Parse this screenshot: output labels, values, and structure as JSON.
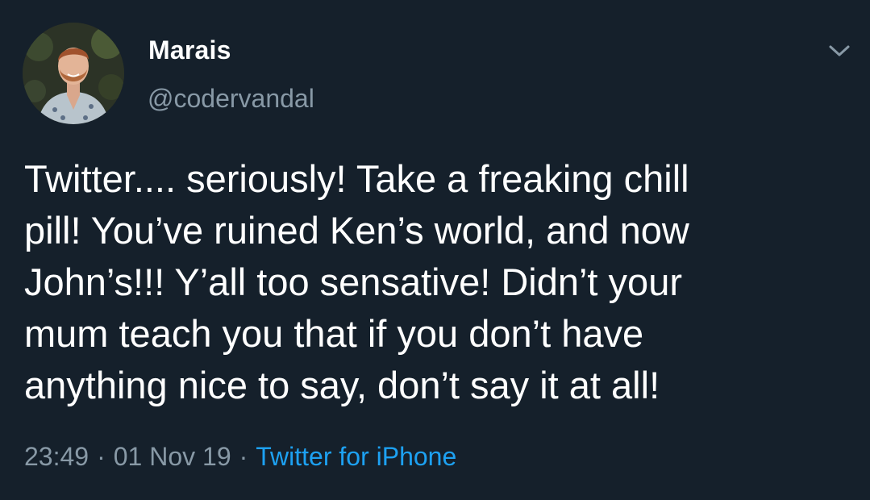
{
  "author": {
    "display_name": "Marais",
    "handle": "@codervandal"
  },
  "menu": {
    "icon": "chevron-down-icon"
  },
  "tweet": {
    "text": "Twitter.... seriously! Take a freaking chill\npill! You’ve ruined Ken’s world, and now\nJohn’s!!! Y’all too sensative! Didn’t your\nmum teach you that if you don’t have\nanything nice to say, don’t say it at all!",
    "time": "23:49",
    "separator": "·",
    "date": "01 Nov 19",
    "source": "Twitter for iPhone"
  },
  "colors": {
    "background": "#15202b",
    "text": "#ffffff",
    "muted": "#8899a6",
    "link": "#1da1f2"
  }
}
